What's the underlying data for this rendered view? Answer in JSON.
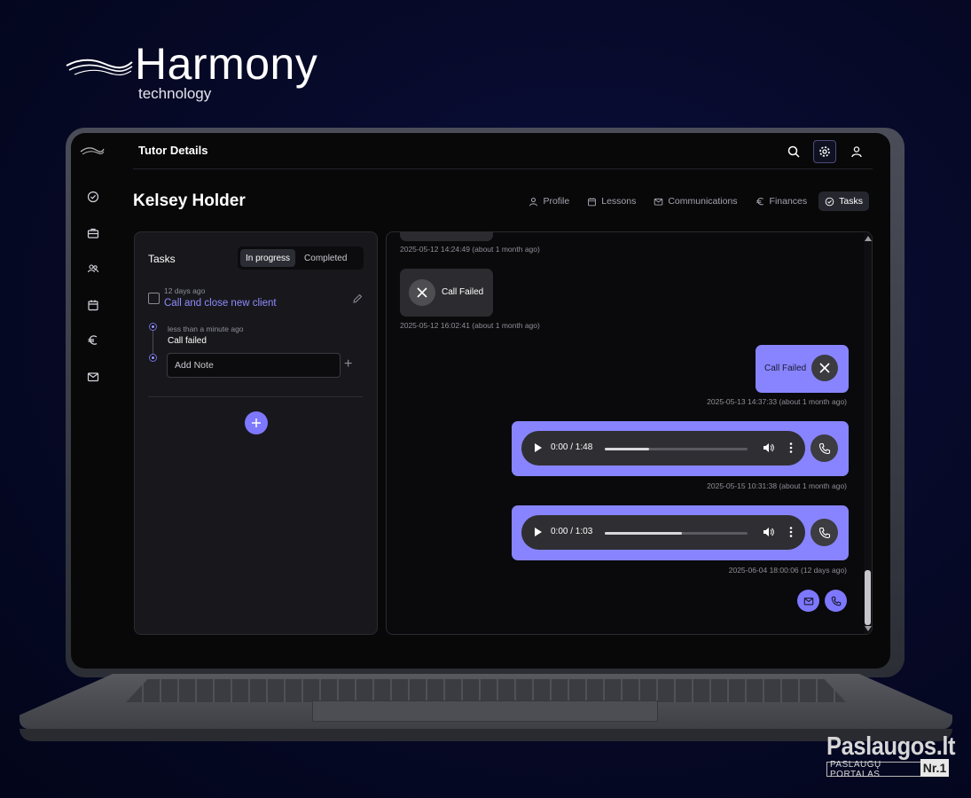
{
  "brand": {
    "name": "Harmony",
    "subtitle": "technology"
  },
  "app": {
    "topbar_title": "Tutor Details",
    "page_title": "Kelsey Holder",
    "top_icons": [
      "search-icon",
      "gear-icon",
      "user-icon"
    ],
    "sidebar_icons": [
      "check-circle-icon",
      "briefcase-icon",
      "users-icon",
      "calendar-icon",
      "euro-icon",
      "mail-icon"
    ],
    "tabs": [
      {
        "label": "Profile",
        "icon": "user-icon",
        "active": false
      },
      {
        "label": "Lessons",
        "icon": "calendar-icon",
        "active": false
      },
      {
        "label": "Communications",
        "icon": "mail-icon",
        "active": false
      },
      {
        "label": "Finances",
        "icon": "euro-icon",
        "active": false
      },
      {
        "label": "Tasks",
        "icon": "check-circle-icon",
        "active": true
      }
    ]
  },
  "tasks": {
    "title": "Tasks",
    "filter": [
      "In progress",
      "Completed"
    ],
    "active_filter": "In progress",
    "items": [
      {
        "time": "12 days ago",
        "title": "Call and close new client",
        "notes": [
          {
            "time": "less than a minute ago",
            "text": "Call failed"
          }
        ]
      }
    ],
    "add_note_placeholder": "Add Note",
    "add_note_plus": "+"
  },
  "communications": {
    "messages": [
      {
        "direction": "incoming",
        "type": "partial",
        "timestamp": "2025-05-12 14:24:49 (about 1 month ago)"
      },
      {
        "direction": "incoming",
        "type": "call_failed",
        "label": "Call Failed",
        "timestamp": "2025-05-12 16:02:41 (about 1 month ago)"
      },
      {
        "direction": "outgoing",
        "type": "call_failed",
        "label": "Call Failed",
        "timestamp": "2025-05-13 14:37:33 (about 1 month ago)"
      },
      {
        "direction": "outgoing",
        "type": "audio",
        "player_time": "0:00 / 1:48",
        "progress": 0.31,
        "timestamp": "2025-05-15 10:31:38 (about 1 month ago)"
      },
      {
        "direction": "outgoing",
        "type": "audio",
        "player_time": "0:00 / 1:03",
        "progress": 0.54,
        "timestamp": "2025-06-04 18:00:06 (12 days ago)"
      }
    ],
    "actions": [
      "mail-icon",
      "phone-icon"
    ],
    "accent_color": "#8884ff"
  },
  "watermark": {
    "main": "Paslaugos.lt",
    "sub": "PASLAUGŲ PORTALAS",
    "badge": "Nr.1"
  }
}
